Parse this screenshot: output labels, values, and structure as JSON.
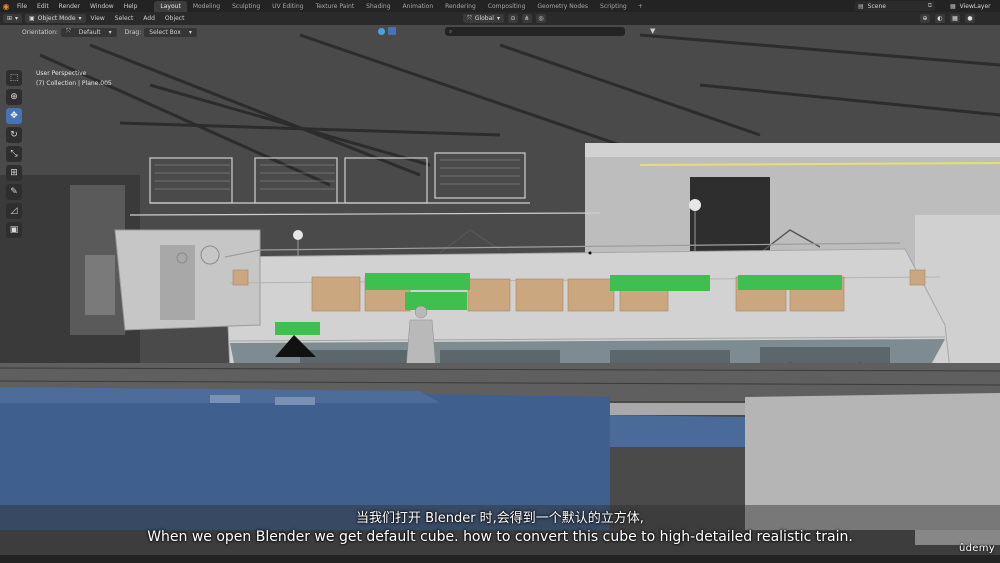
{
  "top_menu": {
    "items": [
      "File",
      "Edit",
      "Render",
      "Window",
      "Help"
    ]
  },
  "workspaces": {
    "tabs": [
      "Layout",
      "Modeling",
      "Sculpting",
      "UV Editing",
      "Texture Paint",
      "Shading",
      "Animation",
      "Rendering",
      "Compositing",
      "Geometry Nodes",
      "Scripting"
    ],
    "active": "Layout",
    "add_label": "+"
  },
  "scene": {
    "name": "Scene"
  },
  "view_layer": {
    "name": "ViewLayer"
  },
  "header": {
    "mode": "Object Mode",
    "menus": [
      "View",
      "Select",
      "Add",
      "Object"
    ],
    "transform_orientation": "Global"
  },
  "tool_settings": {
    "orientation_label": "Orientation:",
    "orientation_value": "Default",
    "drag_label": "Drag:",
    "drag_value": "Select Box"
  },
  "viewport": {
    "view_name": "User Perspective",
    "object_info": "(7) Collection | Plane.005"
  },
  "toolbar": {
    "tools": [
      {
        "name": "select-box-icon",
        "glyph": "⬚"
      },
      {
        "name": "cursor-icon",
        "glyph": "⊕"
      },
      {
        "name": "move-icon",
        "glyph": "✥"
      },
      {
        "name": "rotate-icon",
        "glyph": "↻"
      },
      {
        "name": "scale-icon",
        "glyph": "⤡"
      },
      {
        "name": "transform-icon",
        "glyph": "⊞"
      },
      {
        "name": "annotate-icon",
        "glyph": "✎"
      },
      {
        "name": "measure-icon",
        "glyph": "◿"
      },
      {
        "name": "add-cube-icon",
        "glyph": "▣"
      }
    ],
    "active_index": 2
  },
  "subtitles": {
    "chinese": "当我们打开 Blender 时,会得到一个默认的立方体,",
    "english": "When we open Blender we get default cube. how to convert this cube to high-detailed realistic train."
  },
  "watermark": "ûdemy",
  "colors": {
    "accent_blue": "#4772b3",
    "blender_orange": "#e88a2a",
    "green_panel": "#3fbf4f",
    "water_blue": "#3f5f8f"
  }
}
